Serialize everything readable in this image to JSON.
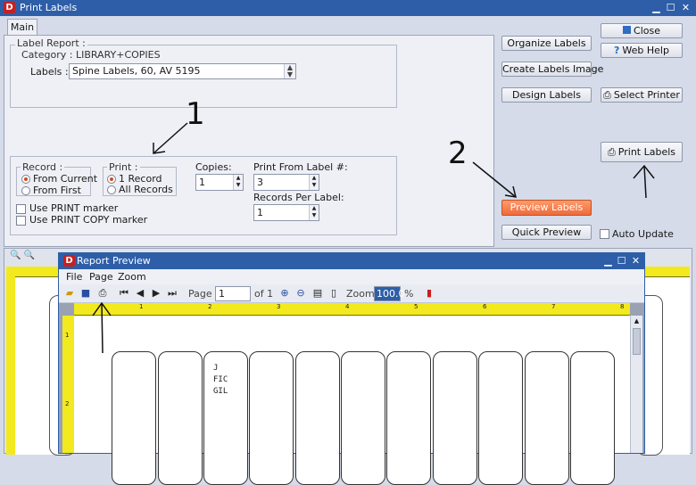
{
  "window": {
    "title": "Print Labels",
    "app_letter": "D"
  },
  "tabs": {
    "main": "Main"
  },
  "label_report": {
    "legend": "Label Report :",
    "category": "Category : LIBRARY+COPIES",
    "labels_label": "Labels :",
    "labels_value": "Spine Labels, 60, AV 5195"
  },
  "record_group": {
    "legend": "Record :",
    "from_current": "From Current",
    "from_first": "From First"
  },
  "print_group": {
    "legend": "Print :",
    "one_record": "1 Record",
    "all_records": "All Records"
  },
  "copies": {
    "label": "Copies:",
    "value": "1"
  },
  "print_from": {
    "label": "Print From Label #:",
    "value": "3"
  },
  "records_per_label": {
    "label": "Records Per Label:",
    "value": "1"
  },
  "checks": {
    "print_marker": "Use PRINT marker",
    "print_copy_marker": "Use PRINT COPY marker"
  },
  "buttons": {
    "organize": "Organize Labels",
    "create_image": "Create Labels Image",
    "design": "Design Labels",
    "close": "Close",
    "web_help": "Web Help",
    "select_printer": "Select Printer",
    "print_labels": "Print Labels",
    "preview_labels": "Preview Labels",
    "quick_preview": "Quick Preview",
    "auto_update": "Auto Update"
  },
  "annotations": {
    "one": "1",
    "two": "2"
  },
  "report_preview": {
    "title": "Report Preview",
    "app_letter": "D",
    "menu": [
      "File",
      "Page",
      "Zoom"
    ],
    "page_label": "Page",
    "page_value": "1",
    "of_label": "of 1",
    "zoom_label": "Zoom",
    "zoom_value": "100.0",
    "percent": "%",
    "ruler_numbers": [
      "1",
      "2",
      "3",
      "4",
      "5",
      "6",
      "7",
      "8"
    ],
    "vertical_ruler_numbers": [
      "1",
      "2"
    ],
    "label_lines": [
      "J",
      "FIC",
      "GIL"
    ]
  },
  "colors": {
    "titlebar": "#2e5ea8",
    "accent_button": "#f06a3a",
    "ruler": "#f3e91f"
  },
  "icons": {
    "close": "close-door-icon",
    "help": "help-icon",
    "printer": "printer-icon",
    "zoom_in": "zoom-in-icon",
    "zoom_out": "zoom-out-icon"
  }
}
